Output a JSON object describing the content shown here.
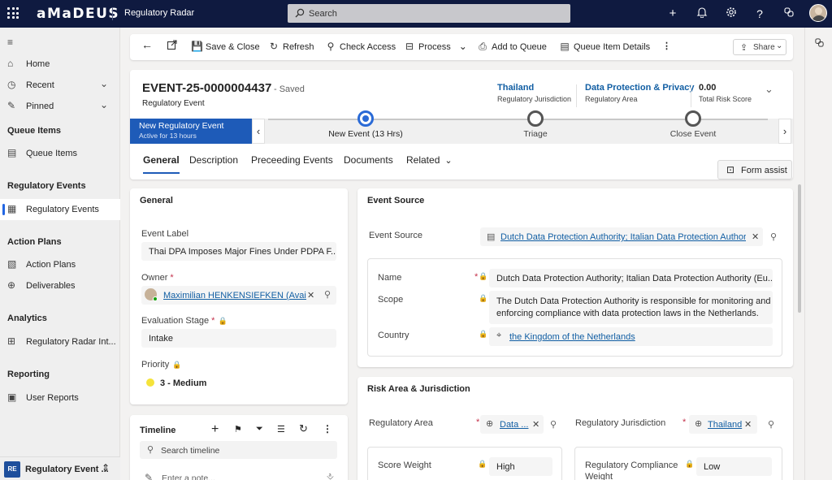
{
  "topbar": {
    "logo": "aMaDEUS",
    "app_name": "Regulatory Radar",
    "search_placeholder": "Search"
  },
  "sidebar": {
    "items": [
      {
        "label": "Home",
        "icon": "home-icon"
      },
      {
        "label": "Recent",
        "icon": "clock-icon"
      },
      {
        "label": "Pinned",
        "icon": "pin-icon"
      }
    ],
    "section_queue": "Queue Items",
    "queue_item": "Queue Items",
    "section_events": "Regulatory Events",
    "events_item": "Regulatory Events",
    "section_plans": "Action Plans",
    "plans_item": "Action Plans",
    "deliverables_item": "Deliverables",
    "section_analytics": "Analytics",
    "analytics_item": "Regulatory Radar Int...",
    "section_reporting": "Reporting",
    "reports_item": "User Reports",
    "area_badge": "RE",
    "area_label": "Regulatory Event ..."
  },
  "commandbar": {
    "save_close": "Save & Close",
    "refresh": "Refresh",
    "check_access": "Check Access",
    "process": "Process",
    "add_to_queue": "Add to Queue",
    "queue_item_details": "Queue Item Details",
    "share": "Share"
  },
  "header": {
    "title": "EVENT-25-0000004437",
    "saved": "- Saved",
    "entity": "Regulatory Event",
    "jurisdiction_value": "Thailand",
    "jurisdiction_label": "Regulatory Jurisdiction",
    "area_value": "Data Protection & Privacy",
    "area_label": "Regulatory Area",
    "score_value": "0.00",
    "score_label": "Total Risk Score"
  },
  "bpf": {
    "active_title": "New Regulatory Event",
    "active_sub": "Active for 13 hours",
    "stages": [
      "New Event  (13 Hrs)",
      "Triage",
      "Close Event"
    ]
  },
  "tabs": [
    "General",
    "Description",
    "Preceeding Events",
    "Documents",
    "Related"
  ],
  "form_assist": "Form assist",
  "general": {
    "title": "General",
    "event_label_label": "Event Label",
    "event_label_value": "Thai DPA Imposes Major Fines Under PDPA F...",
    "owner_label": "Owner",
    "owner_value": "Maximilian HENKENSIEFKEN (Available)",
    "stage_label": "Evaluation Stage",
    "stage_value": "Intake",
    "priority_label": "Priority",
    "priority_value": "3 - Medium",
    "priority_color": "#f5e33a"
  },
  "timeline": {
    "title": "Timeline",
    "search_placeholder": "Search timeline",
    "note_placeholder": "Enter a note..."
  },
  "event_source": {
    "title": "Event Source",
    "source_label": "Event Source",
    "source_value": "Dutch Data Protection Authority; Italian Data Protection Authorit...",
    "name_label": "Name",
    "name_value": "Dutch Data Protection Authority; Italian Data Protection Authority (Eu...",
    "scope_label": "Scope",
    "scope_value_1": "The Dutch Data Protection Authority is responsible for monitoring and",
    "scope_value_2": "enforcing compliance with data protection laws in the Netherlands.",
    "country_label": "Country",
    "country_value": "the Kingdom of the Netherlands"
  },
  "risk": {
    "title": "Risk Area & Jurisdiction",
    "area_label": "Regulatory Area",
    "area_value": "Data ...",
    "jurisdiction_label": "Regulatory Jurisdiction",
    "jurisdiction_value": "Thailand",
    "score_weight_label": "Score Weight",
    "score_weight_value": "High",
    "compliance_label_1": "Regulatory Compliance",
    "compliance_label_2": "Weight",
    "compliance_value": "Low"
  }
}
